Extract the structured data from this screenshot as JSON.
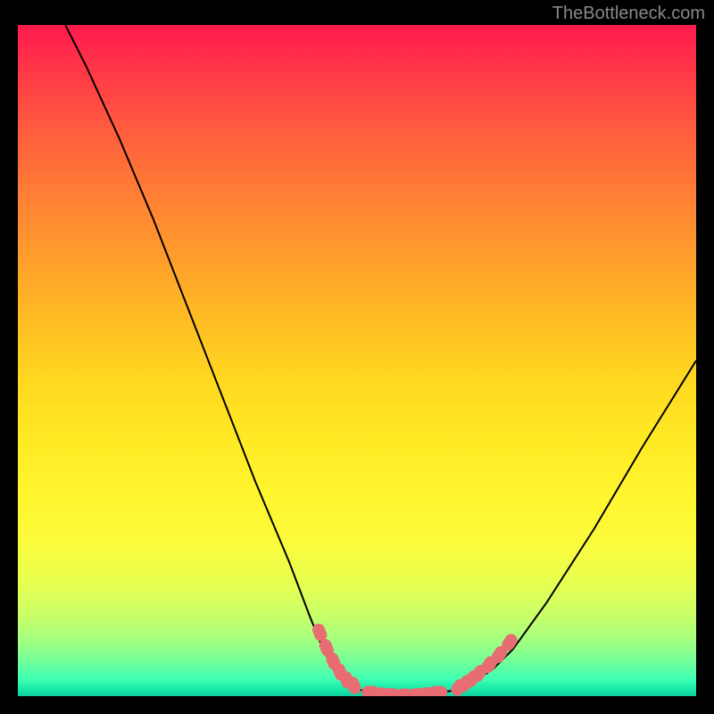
{
  "watermark": "TheBottleneck.com",
  "chart_data": {
    "type": "line",
    "title": "",
    "xlabel": "",
    "ylabel": "",
    "xlim": [
      0,
      100
    ],
    "ylim": [
      0,
      100
    ],
    "curve": [
      {
        "x": 7,
        "y": 100
      },
      {
        "x": 10,
        "y": 94
      },
      {
        "x": 15,
        "y": 83
      },
      {
        "x": 20,
        "y": 71
      },
      {
        "x": 25,
        "y": 58
      },
      {
        "x": 30,
        "y": 45
      },
      {
        "x": 35,
        "y": 32
      },
      {
        "x": 40,
        "y": 20
      },
      {
        "x": 43,
        "y": 12
      },
      {
        "x": 45,
        "y": 7
      },
      {
        "x": 47,
        "y": 3
      },
      {
        "x": 50,
        "y": 1
      },
      {
        "x": 54,
        "y": 0.3
      },
      {
        "x": 57,
        "y": 0.2
      },
      {
        "x": 60,
        "y": 0.3
      },
      {
        "x": 64,
        "y": 0.8
      },
      {
        "x": 67,
        "y": 2
      },
      {
        "x": 70,
        "y": 4
      },
      {
        "x": 73,
        "y": 7
      },
      {
        "x": 78,
        "y": 14
      },
      {
        "x": 85,
        "y": 25
      },
      {
        "x": 92,
        "y": 37
      },
      {
        "x": 100,
        "y": 50
      }
    ],
    "markers_left": [
      {
        "x": 44.5,
        "y": 9.5
      },
      {
        "x": 45.5,
        "y": 7.2
      },
      {
        "x": 46.5,
        "y": 5.2
      },
      {
        "x": 47.5,
        "y": 3.6
      },
      {
        "x": 48.5,
        "y": 2.4
      },
      {
        "x": 49.5,
        "y": 1.6
      }
    ],
    "markers_bottom": [
      {
        "x": 52,
        "y": 0.6
      },
      {
        "x": 53.5,
        "y": 0.35
      },
      {
        "x": 55,
        "y": 0.25
      },
      {
        "x": 57,
        "y": 0.2
      },
      {
        "x": 59,
        "y": 0.25
      },
      {
        "x": 60.5,
        "y": 0.4
      },
      {
        "x": 62,
        "y": 0.6
      }
    ],
    "markers_right": [
      {
        "x": 65,
        "y": 1.3
      },
      {
        "x": 66,
        "y": 1.9
      },
      {
        "x": 67,
        "y": 2.6
      },
      {
        "x": 68,
        "y": 3.4
      },
      {
        "x": 69.5,
        "y": 4.7
      },
      {
        "x": 71,
        "y": 6.2
      },
      {
        "x": 72.5,
        "y": 8.0
      }
    ],
    "marker_color": "#e86d72",
    "curve_color": "#000000"
  }
}
